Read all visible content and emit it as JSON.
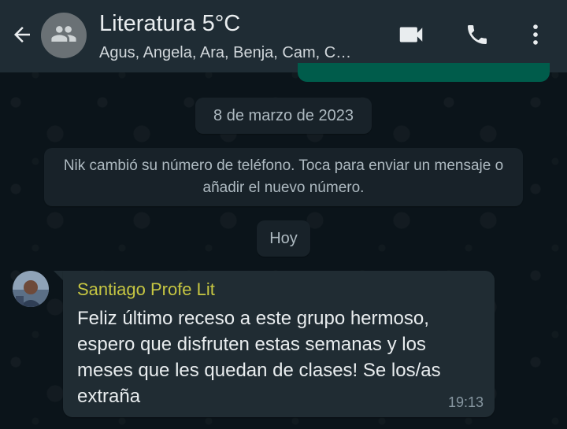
{
  "header": {
    "title": "Literatura 5°C",
    "members": "Agus, Angela, Ara, Benja, Cam, C…",
    "icons": {
      "back": "arrow-back-icon",
      "group_avatar": "group-icon",
      "video": "video-camera-icon",
      "call": "phone-icon",
      "menu": "more-vertical-icon"
    }
  },
  "chat": {
    "date_separator": "8 de marzo de 2023",
    "system_message": "Nik cambió su número de teléfono. Toca para enviar un mensaje o añadir el nuevo número.",
    "today_separator": "Hoy",
    "messages": [
      {
        "sender": "Santiago Profe Lit",
        "text": "Feliz último receso a este grupo hermoso, espero que disfruten estas semanas y los meses que les quedan de clases! Se los/as extraña",
        "time": "19:13"
      }
    ]
  },
  "colors": {
    "header_bg": "#1f2c34",
    "chat_bg": "#0b141a",
    "bubble_incoming": "#202c33",
    "bubble_outgoing": "#005c4b",
    "sender_name": "#c7c742",
    "text_primary": "#e9edef",
    "text_secondary": "#8696a0"
  }
}
